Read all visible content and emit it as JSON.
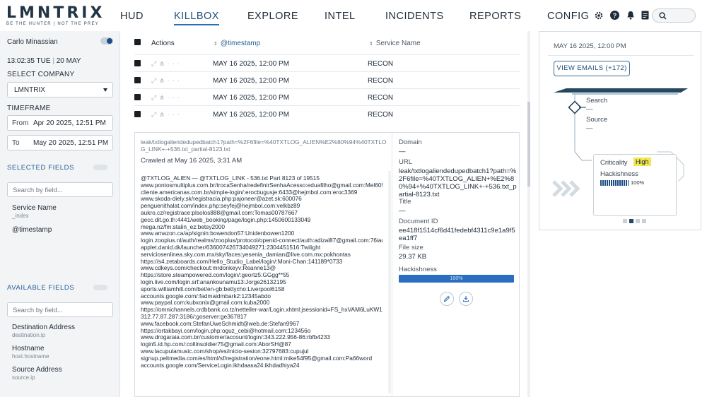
{
  "brand": {
    "logo": "LMNTRIX",
    "tagline": "BE THE HUNTER  |  NOT THE PREY"
  },
  "nav": [
    "HUD",
    "KILLBOX",
    "EXPLORE",
    "INTEL",
    "INCIDENTS",
    "REPORTS",
    "CONFIG"
  ],
  "nav_active": "KILLBOX",
  "top_icons": [
    "gear-icon",
    "help-icon",
    "bell-icon",
    "document-icon",
    "search-icon"
  ],
  "left": {
    "user": "Carlo Minassian",
    "time": "13:02:35",
    "day": "TUE",
    "date": "20 MAY",
    "select_company_label": "SELECT COMPANY",
    "company": "LMNTRIX",
    "timeframe_label": "TIMEFRAME",
    "from_label": "From",
    "from_value": "Apr 20 2025, 12:51 PM",
    "to_label": "To",
    "to_value": "May 20 2025, 12:51 PM",
    "selected_fields_label": "SELECTED FIELDS",
    "selected_search_placeholder": "Search by field...",
    "selected_fields": [
      {
        "name": "Service Name",
        "sub": "_index"
      },
      {
        "name": "@timestamp",
        "sub": ""
      }
    ],
    "available_fields_label": "AVAILABLE FIELDS",
    "available_search_placeholder": "Search by field...",
    "available_fields": [
      {
        "name": "Destination Address",
        "sub": "destination.ip"
      },
      {
        "name": "Hostname",
        "sub": "host.hostname"
      },
      {
        "name": "Source Address",
        "sub": "source.ip"
      }
    ]
  },
  "table": {
    "headers": {
      "actions": "Actions",
      "timestamp": "@timestamp",
      "service": "Service Name"
    },
    "rows": [
      {
        "timestamp": "MAY 16 2025, 12:00 PM",
        "service": "RECON"
      },
      {
        "timestamp": "MAY 16 2025, 12:00 PM",
        "service": "RECON"
      },
      {
        "timestamp": "MAY 16 2025, 12:00 PM",
        "service": "RECON"
      },
      {
        "timestamp": "MAY 16 2025, 12:00 PM",
        "service": "RECON"
      }
    ]
  },
  "detail": {
    "url": "leak/txtlogaliendedupedbatch1?path=%2F6file=%40TXTLOG_ALIEN%E2%80%94%40TXTLOG_LINK+-+536.txt_partial-8123.txt",
    "crawled": "Crawled at May 16 2025, 3:31 AM",
    "text_lines": [
      "@TXTLOG_ALIEN — @TXTLOG_LINK - 536.txt Part 8123 of 19515",
      "www.pontosmultiplus.com.br/trocaSenha/redefinirSenhaAcesso:eduafilho@gmail.com:Mel60508",
      "cliente.americanas.com.br/simple-login/:erocbugusje:6433@hejmbol.com:eroc3369",
      "www.skoda-diely.sk/registracia.php:pajoneer@azet.sk:600076",
      "penguenithalat.com/index.php:seyfej@hejmbol.com:velkbz89",
      "aukro.cz/registrace:plsolos888@gmail.com:Tomas00787667",
      "gecc.dit.go.th:4441/web_booking/page/login.php:1450600133049",
      "mega.nz/fm:stalin_ez:betsy2000",
      "www.amazon.ca/ap/signin:bowendon57:Unidenbowen1200",
      "login.zooplus.nl/auth/realms/zooplus/protocol/openid-connect/auth:adizal87@gmail.com:76iaq669",
      "applet.danid.dk/launcher/636007426734049271:2304451516:Twilight",
      "serviciosenlinea.sky.com.mx/sky/faces:yesenia_damian@live.com.mx:pokhontas",
      "https://s4.zetaboards.com/Hello_Studio_Label/login/:Moni-Chan:141189*0733",
      "www.cdkeys.com/checkout:mrdonkeyv:Reanne13@",
      "https://store.steampowered.com/login/:geortz5:GGgg**55",
      "login.live.com/login.srf:anankounamu13:Jorge26132195",
      "sports.williamhill.com/bet/en-gb:bettycho:Liverpool6158",
      "accounts.google.com/:fadmaidmbark2:12345abdo",
      "www.paypal.com:kubxonix@gmail.com:kuba2000",
      "https://omnichannels.crdbbank.co.tz/netteller-war/Login.xhtml:jsessionid=FS_hxVAM6LuKW1fa2EYi-VRbvXaRMOj7tH-6F6RO.node1:361813:Arnoldalex000@",
      "312.77.87.287:3186/:goserver:ge367817",
      "www.facebook.com:StefanUweSchmidt@web.de:Stefan9967",
      "https://ortakbayi.com/login.php:oguz_cebi@hotmail.com:123456o",
      "www.drogaraia.com.br/customer/account/login/:343.222.956-86:rbfb4233",
      "login5.id.hp.com/:collinsoldier75@gmail.com:AborSH@87",
      "www.lacupulamusic.com/shop/es/inicio-sesion:32797683:cupujul",
      "signup.peltmedia.com/es/html/sf/registration/eone.html:mike54f95@gmail.com:Pa66word",
      "accounts.google.com/ServiceLogin:ikhdaasa24:ikhdadhiya24"
    ],
    "domain_label": "Domain",
    "domain_value": "—",
    "url_label": "URL",
    "url_value": "leak/txtlogaliendedupedbatch1?path=%2F6file=%40TXTLOG_ALIEN+%E2%80%94+%40TXTLOG_LINK+-+536.txt_partial-8123.txt",
    "title_label": "Title",
    "title_value": "—",
    "docid_label": "Document ID",
    "docid_value": "ee418f1514cf6d41fedebf4311c9e1a9f5ea1ff7",
    "filesize_label": "File size",
    "filesize_value": "29.37 KB",
    "hackishness_label": "Hackishness",
    "hackishness_value": "100%",
    "hackishness_fraction": 1.0
  },
  "right": {
    "date": "MAY 16 2025, 12:00 PM",
    "view_emails": "VIEW EMAILS (+172)",
    "search_label": "Search",
    "search_value": "—",
    "source_label": "Source",
    "source_value": "—",
    "criticality_label": "Criticality",
    "criticality_value": "High",
    "hackishness_label": "Hackishness",
    "hackishness_value": "100%",
    "colors": {
      "criticality_high": "#f2e84b",
      "accent": "#1d4d86"
    }
  }
}
